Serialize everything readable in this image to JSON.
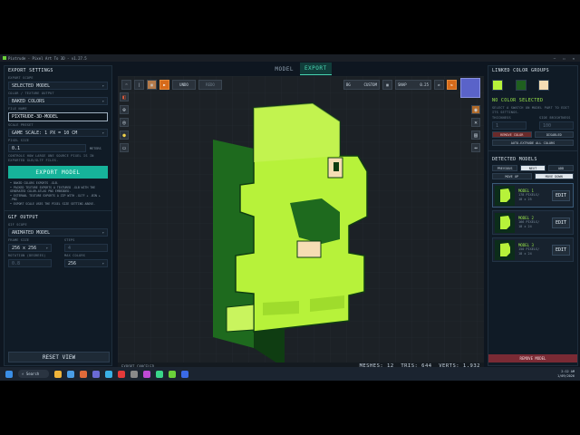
{
  "app": {
    "title": "Pixtrude - Pixel Art To 3D - v1.27.5",
    "tabs": [
      "MODEL",
      "EXPORT"
    ],
    "active_tab": "EXPORT"
  },
  "left_panel": {
    "export_settings_title": "EXPORT SETTINGS",
    "export_scope_label": "EXPORT SCOPE",
    "export_scope_value": "SELECTED MODEL",
    "color_output_label": "COLOR / TEXTURE OUTPUT",
    "color_output_value": "BAKED COLORS",
    "file_name_label": "FILE NAME",
    "file_name_value": "PIXTRUDE-3D-MODEL",
    "scale_preset_label": "SCALE PRESET",
    "scale_preset_value": "GAME SCALE: 1 PX = 10 CM",
    "pixel_size_label": "PIXEL SIZE",
    "pixel_size_value": "0.1",
    "pixel_size_unit": "METERS",
    "pixel_size_help": "CONTROLS HOW LARGE ONE SOURCE PIXEL IS IN EXPORTED GLB/GLTF FILES.",
    "export_button": "EXPORT MODEL",
    "bullets": [
      "BAKED COLORS EXPORTS .GLB.",
      "PACKED TEXTURE EXPORTS A TEXTURED .GLB WITH THE GENERATED COLOR-ATLAS PNG EMBEDDED.",
      "EXTERNAL TEXTURE EXPORTS A ZIP WITH .GLTF + .BIN + .PNG",
      "EXPORT SCALE USES THE PIXEL SIZE SETTING ABOVE."
    ],
    "gif_title": "GIF OUTPUT",
    "gif_scope_label": "GIF SCOPE",
    "gif_scope_value": "ANIMATED MODEL",
    "frame_size_label": "FRAME SIZE",
    "frame_size_value": "256 x 256",
    "steps_label": "STEPS",
    "steps_value": "4",
    "rotation_label": "ROTATION (DEGREES)",
    "rotation_value": "0.8",
    "max_colors_label": "MAX COLORS",
    "max_colors_value": "256",
    "reset_button": "RESET VIEW"
  },
  "toolbar": {
    "undo": "UNDO",
    "redo": "REDO",
    "bg_label": "BG",
    "bg_value": "CUSTOM",
    "snap_label": "SNAP",
    "snap_value": "0.25"
  },
  "status": {
    "message": "EXPORT CANCELED.",
    "meshes": "MESHES: 12",
    "tris": "TRIS: 644",
    "verts": "VERTS: 1,932"
  },
  "right_panel": {
    "linked_title": "LINKED COLOR GROUPS",
    "swatch_colors": [
      "#b7f23a",
      "#1f5f1f",
      "#f6ddb4"
    ],
    "no_color_title": "NO COLOR SELECTED",
    "no_color_help": "SELECT A SWATCH ON MODEL PART TO EDIT ITS SETTINGS.",
    "thickness_label": "THICKNESS",
    "thickness_value": "1",
    "brightness_label": "SIDE BRIGHTNESS",
    "brightness_value": "100",
    "remove_color": "REMOVE COLOR",
    "disabled": "DISABLED",
    "auto_extrude": "AUTO-EXTRUDE ALL COLORS",
    "detected_title": "DETECTED MODELS",
    "previous": "PREVIOUS",
    "next": "NEXT",
    "add": "ADD",
    "move_up": "MOVE UP",
    "move_down": "MOVE DOWN",
    "models": [
      {
        "name": "MODEL 1",
        "info1": "178 PIXELS/",
        "info2": "18 x 25"
      },
      {
        "name": "MODEL 2",
        "info1": "166 PIXELS/",
        "info2": "18 x 24"
      },
      {
        "name": "MODEL 3",
        "info1": "150 PIXELS/",
        "info2": "18 x 24"
      }
    ],
    "edit": "EDIT",
    "remove_model": "REMOVE MODEL"
  },
  "taskbar": {
    "search": "Search",
    "time": "2:12 AM",
    "date": "1/09/2026"
  }
}
